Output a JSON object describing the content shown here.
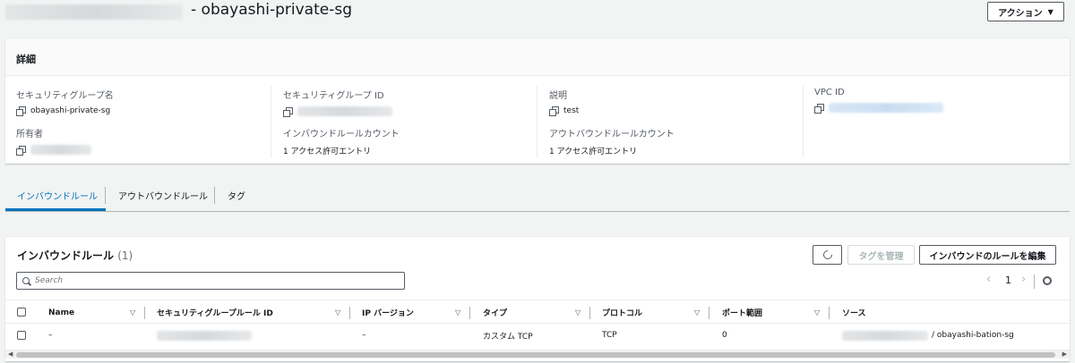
{
  "header": {
    "title": "- obayashi-private-sg",
    "action_label": "アクション"
  },
  "details": {
    "heading": "詳細",
    "fields": {
      "sg_name_label": "セキュリティグループ名",
      "sg_name_value": "obayashi-private-sg",
      "sg_id_label": "セキュリティグループ ID",
      "description_label": "説明",
      "description_value": "test",
      "vpc_id_label": "VPC ID",
      "owner_label": "所有者",
      "inbound_count_label": "インバウンドルールカウント",
      "inbound_count_value": "1 アクセス許可エントリ",
      "outbound_count_label": "アウトバウンドルールカウント",
      "outbound_count_value": "1 アクセス許可エントリ"
    }
  },
  "tabs": [
    {
      "label": "インバウンドルール",
      "active": true
    },
    {
      "label": "アウトバウンドルール",
      "active": false
    },
    {
      "label": "タグ",
      "active": false
    }
  ],
  "rules": {
    "title": "インバウンドルール",
    "count": "(1)",
    "manage_tags_label": "タグを管理",
    "edit_rules_label": "インバウンドのルールを編集",
    "search_placeholder": "Search",
    "page_number": "1",
    "columns": [
      "Name",
      "セキュリティグループルール ID",
      "IP バージョン",
      "タイプ",
      "プロトコル",
      "ポート範囲",
      "ソース"
    ],
    "rows": [
      {
        "name": "–",
        "ip_version": "–",
        "type": "カスタム TCP",
        "protocol": "TCP",
        "port_range": "0",
        "source": "/ obayashi-bation-sg"
      }
    ]
  },
  "colors": {
    "accent": "#0073bb",
    "text": "#16191f",
    "muted": "#545b64",
    "background": "#f2f3f3"
  }
}
